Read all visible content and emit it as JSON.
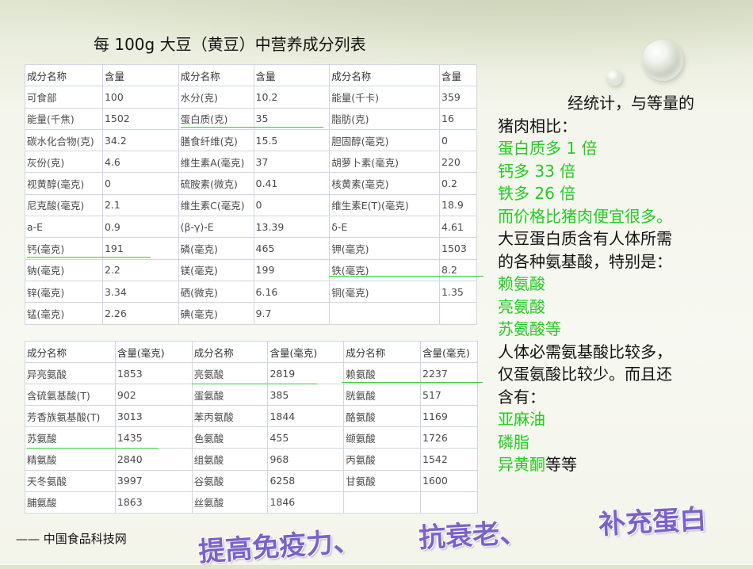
{
  "title": "每 100g 大豆（黄豆）中营养成分列表",
  "table1": {
    "rows": [
      [
        "成分名称",
        "含量",
        "成分名称",
        "含量",
        "成分名称",
        "含量"
      ],
      [
        "可食部",
        "100",
        "水分(克)",
        "10.2",
        "能量(千卡)",
        "359"
      ],
      [
        "能量(千焦)",
        "1502",
        "蛋白质(克)",
        "35",
        "脂肪(克)",
        "16"
      ],
      [
        "碳水化合物(克)",
        "34.2",
        "膳食纤维(克)",
        "15.5",
        "胆固醇(毫克)",
        "0"
      ],
      [
        "灰份(克)",
        "4.6",
        "维生素A(毫克)",
        "37",
        "胡萝卜素(毫克)",
        "220"
      ],
      [
        "视黄醇(毫克)",
        "0",
        "硫胺素(微克)",
        "0.41",
        "核黄素(毫克)",
        "0.2"
      ],
      [
        "尼克酸(毫克)",
        "2.1",
        "维生素C(毫克)",
        "0",
        "维生素E(T)(毫克)",
        "18.9"
      ],
      [
        "a-E",
        "0.9",
        "(β-γ)-E",
        "13.39",
        "δ-E",
        "4.61"
      ],
      [
        "钙(毫克)",
        "191",
        "磷(毫克)",
        "465",
        "钾(毫克)",
        "1503"
      ],
      [
        "钠(毫克)",
        "2.2",
        "镁(毫克)",
        "199",
        "铁(毫克)",
        "8.2"
      ],
      [
        "锌(毫克)",
        "3.34",
        "硒(微克)",
        "6.16",
        "铜(毫克)",
        "1.35"
      ],
      [
        "锰(毫克)",
        "2.26",
        "碘(毫克)",
        "9.7",
        "",
        ""
      ]
    ]
  },
  "table2": {
    "rows": [
      [
        "成分名称",
        "含量(毫克)",
        "成分名称",
        "含量(毫克)",
        "成分名称",
        "含量(毫克)"
      ],
      [
        "异亮氨酸",
        "1853",
        "亮氨酸",
        "2819",
        "赖氨酸",
        "2237"
      ],
      [
        "含硫氨基酸(T)",
        "902",
        "蛋氨酸",
        "385",
        "胱氨酸",
        "517"
      ],
      [
        "芳香族氨基酸(T)",
        "3013",
        "苯丙氨酸",
        "1844",
        "酪氨酸",
        "1169"
      ],
      [
        "苏氨酸",
        "1435",
        "色氨酸",
        "455",
        "缬氨酸",
        "1726"
      ],
      [
        "精氨酸",
        "2840",
        "组氨酸",
        "968",
        "丙氨酸",
        "1542"
      ],
      [
        "天冬氨酸",
        "3997",
        "谷氨酸",
        "6258",
        "甘氨酸",
        "1600"
      ],
      [
        "脯氨酸",
        "1863",
        "丝氨酸",
        "1846",
        "",
        ""
      ]
    ]
  },
  "summary": {
    "line1": "经统计，与等量的",
    "line2": "猪肉相比：",
    "protein": "蛋白质多 1 倍",
    "calcium": "钙多 33 倍",
    "iron": "铁多 26 倍",
    "price": "而价格比猪肉便宜很多。",
    "line3": "大豆蛋白质含有人体所需",
    "line4": "的各种氨基酸，特别是：",
    "aa1": "赖氨酸",
    "aa2": "亮氨酸",
    "aa3": "苏氨酸等",
    "line5": "人体必需氨基酸比较多，",
    "line6": "仅蛋氨酸比较少。而且还",
    "line7": "含有：",
    "item1": "亚麻油",
    "item2": "磷脂",
    "item3": "异黄酮",
    "item3_suffix": "等等"
  },
  "credit": "—— 中国食品科技网",
  "wordart": {
    "w1": "提高免疫力、",
    "w2": "抗衰老、",
    "w3": "补充蛋白"
  },
  "colors": {
    "highlight_green": "#22cc22",
    "underline_green": "#33cc33",
    "wordart_purple": "#7b62c8",
    "table_border": "#cfd6e2"
  }
}
